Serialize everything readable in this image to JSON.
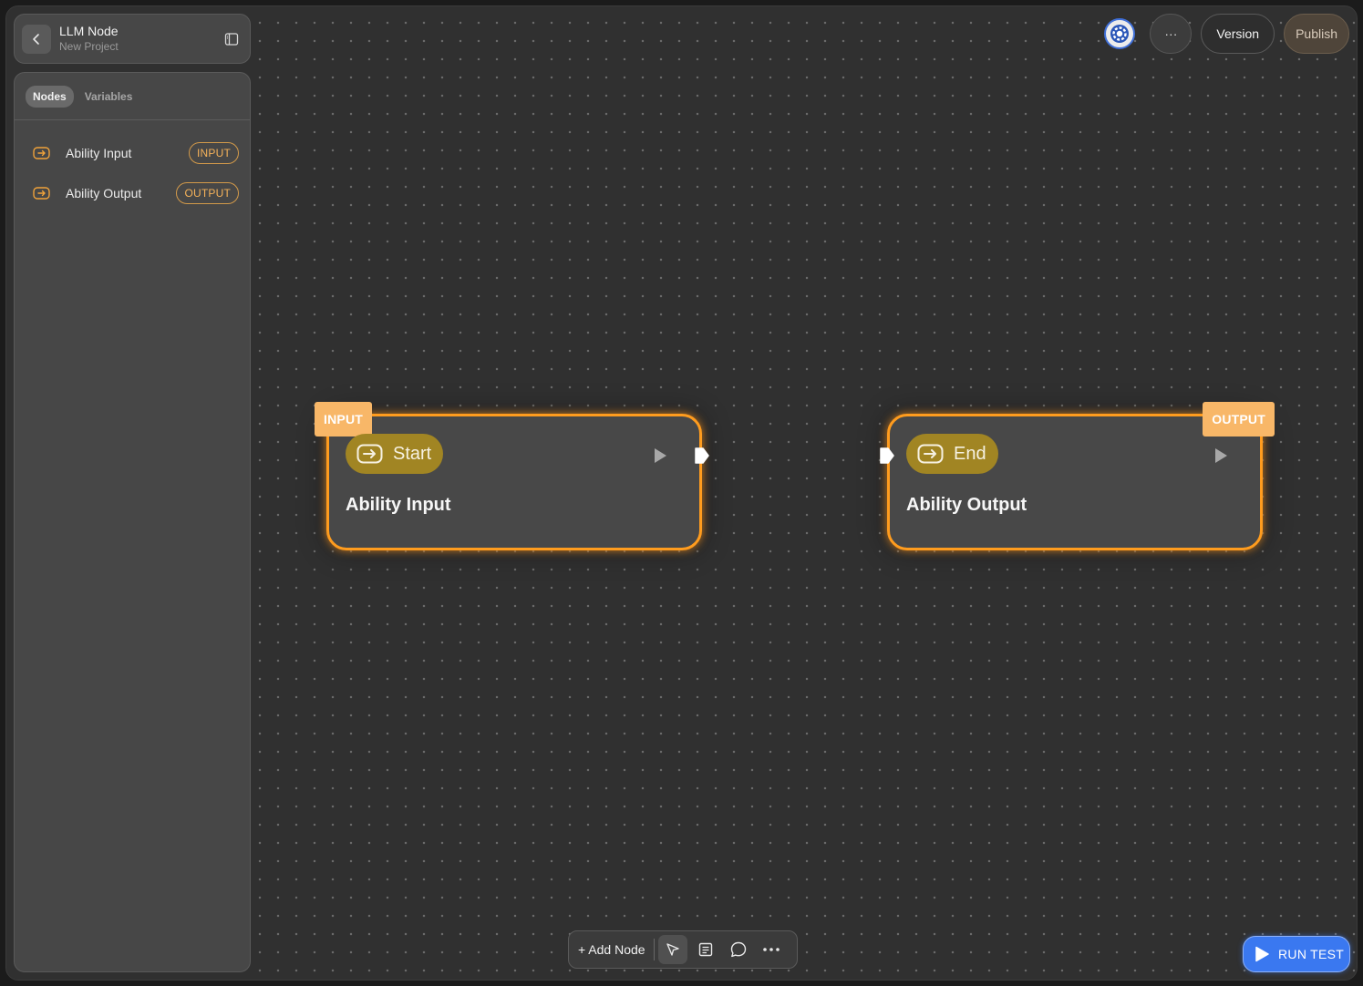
{
  "header": {
    "title": "LLM Node",
    "subtitle": "New Project",
    "back_icon": "chevron-left-icon",
    "panel_icon": "sidebar-toggle-icon"
  },
  "sidebar": {
    "tabs": [
      {
        "label": "Nodes",
        "active": true
      },
      {
        "label": "Variables",
        "active": false
      }
    ],
    "items": [
      {
        "label": "Ability Input",
        "badge": "INPUT",
        "icon": "arrow-box-icon"
      },
      {
        "label": "Ability Output",
        "badge": "OUTPUT",
        "icon": "arrow-box-icon"
      }
    ]
  },
  "top_right": {
    "avatar_icon": "settings-gear-avatar-icon",
    "more_label": "···",
    "version_label": "Version",
    "publish_label": "Publish"
  },
  "canvas": {
    "nodes": [
      {
        "tag": "INPUT",
        "chip_label": "Start",
        "title": "Ability Input",
        "handle": "output"
      },
      {
        "tag": "OUTPUT",
        "chip_label": "End",
        "title": "Ability Output",
        "handle": "input"
      }
    ]
  },
  "toolbar": {
    "add_node_label": "+ Add Node",
    "tools": [
      "pointer-icon",
      "note-icon",
      "comment-icon",
      "more-horizontal-icon"
    ]
  },
  "run_test": {
    "label": "RUN TEST",
    "icon": "play-icon"
  },
  "colors": {
    "accent_orange": "#ff9c1e",
    "tag_orange": "#f8b768",
    "chip_gold": "#a18523",
    "run_blue": "#3a78f0",
    "badge_text": "#f5b25a"
  }
}
